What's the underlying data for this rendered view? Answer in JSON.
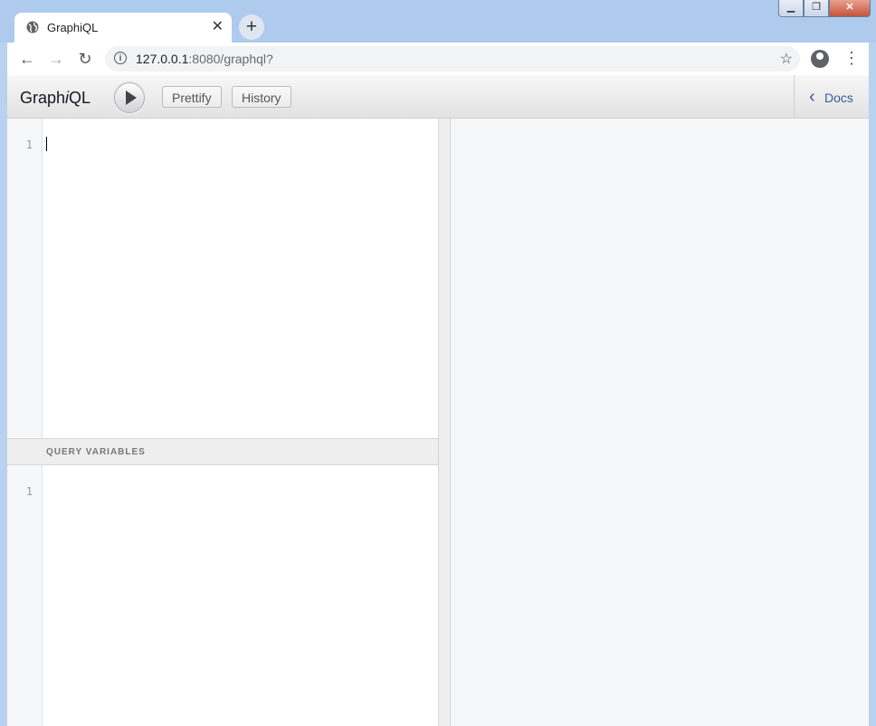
{
  "browser": {
    "tab_title": "GraphiQL",
    "tab_close": "✕",
    "new_tab": "+",
    "url_host": "127.0.0.1",
    "url_rest": ":8080/graphql?",
    "back_icon": "arrow-left",
    "forward_icon": "arrow-right",
    "reload_icon": "reload"
  },
  "graphiql": {
    "brand_prefix": "Graph",
    "brand_italic": "i",
    "brand_suffix": "QL",
    "prettify_label": "Prettify",
    "history_label": "History",
    "docs_label": "Docs",
    "query_line_number": "1",
    "variables_title": "QUERY VARIABLES",
    "variables_line_number": "1"
  },
  "colors": {
    "docs_accent": "#3b5998"
  }
}
